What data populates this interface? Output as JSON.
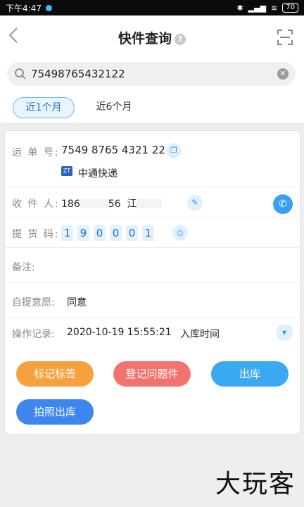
{
  "status_bar": {
    "time": "下午4:47",
    "battery": "70"
  },
  "header": {
    "title": "快件查询",
    "back_icon": "chevron-left-icon",
    "scan_icon": "scan-icon",
    "help_icon": "help-circle-icon",
    "help_glyph": "?"
  },
  "search": {
    "value": "75498765432122",
    "icon": "search-icon",
    "clear_icon": "clear-icon"
  },
  "tabs": [
    {
      "label": "近1个月",
      "active": true
    },
    {
      "label": "近6个月",
      "active": false
    }
  ],
  "detail": {
    "waybill": {
      "label": "运 单 号:",
      "value": "7549 8765 4321 22",
      "courier": "中通快递"
    },
    "receiver": {
      "label": "收 件 人:",
      "phone_start": "186",
      "phone_end": "56",
      "name_start": "江"
    },
    "pickup_code": {
      "label": "提 货 码:",
      "digits": [
        "1",
        "9",
        "0",
        "0",
        "0",
        "1"
      ]
    },
    "note": {
      "label": "备注:",
      "value": ""
    },
    "self_pickup": {
      "label": "自提意愿:",
      "value": "同意"
    },
    "log": {
      "label": "操作记录:",
      "time": "2020-10-19 15:55:21",
      "event": "入库时间"
    }
  },
  "actions": {
    "tag": "标记标签",
    "problem": "登记问题件",
    "checkout": "出库",
    "photo_checkout": "拍照出库"
  },
  "watermark": "大玩客",
  "colors": {
    "accent": "#3a9ff0",
    "orange": "#f5a13e",
    "red": "#f1736f",
    "blue": "#3c86ee"
  }
}
